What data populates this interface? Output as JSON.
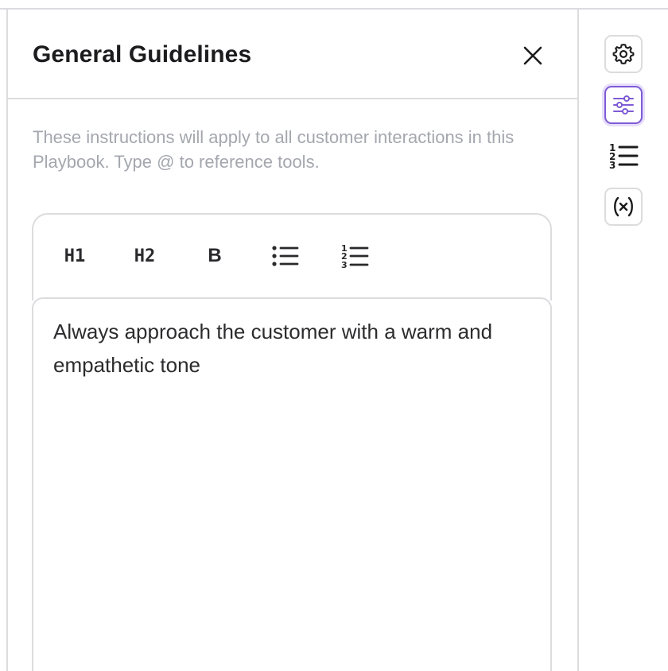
{
  "panel": {
    "title": "General Guidelines",
    "description": "These instructions will apply to all customer interactions in this Playbook. Type @ to reference tools."
  },
  "toolbar": {
    "h1_label": "H1",
    "h2_label": "H2",
    "bold_label": "B",
    "bullet_list_icon": "bullet-list-icon",
    "numbered_list_icon": "numbered-list-icon"
  },
  "editor": {
    "content": "Always approach the customer with a warm and empathetic tone"
  },
  "side_rail": {
    "items": [
      {
        "icon": "gear-icon",
        "active": false
      },
      {
        "icon": "sliders-icon",
        "active": true
      },
      {
        "icon": "numbered-list-icon",
        "active": false
      },
      {
        "icon": "variable-icon",
        "active": false
      }
    ]
  },
  "colors": {
    "accent": "#7e5bd6",
    "border": "#dcdcdf",
    "muted_text": "#a4a7ae",
    "text": "#2c2c2e"
  }
}
